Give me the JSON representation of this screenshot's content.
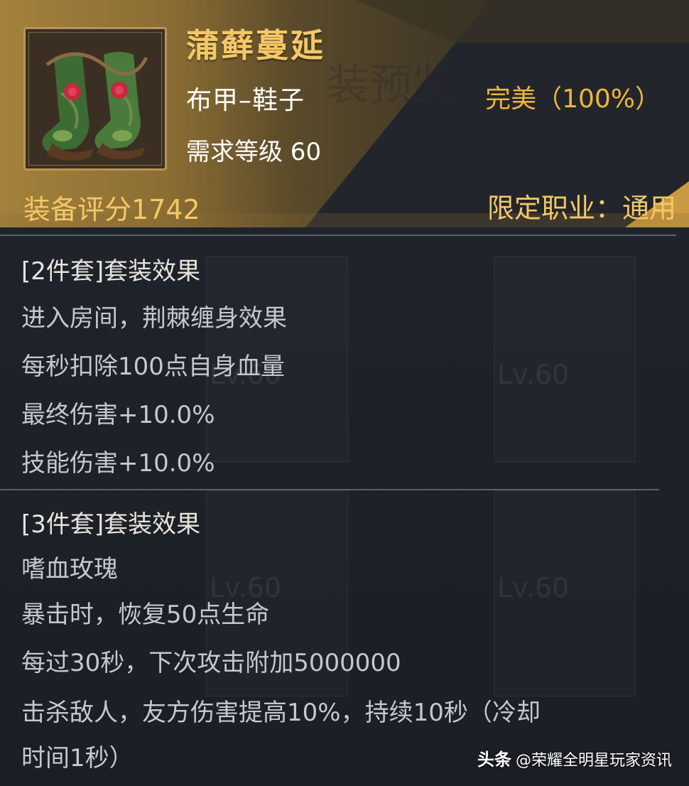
{
  "item": {
    "name": "蒲藓蔓延",
    "type": "布甲–鞋子",
    "required_level": "需求等级 60",
    "quality": "完美（100%）",
    "score": "装备评分1742",
    "class_restriction": "限定职业：通用",
    "icon": "thorn-boots-icon"
  },
  "set_2": {
    "title": "[2件套]套装效果",
    "lines": [
      "进入房间，荆棘缠身效果",
      "每秒扣除100点自身血量",
      "最终伤害+10.0%",
      "技能伤害+10.0%"
    ]
  },
  "set_3": {
    "title": "[3件套]套装效果",
    "lines": [
      "嗜血玫瑰",
      "暴击时，恢复50点生命",
      "每过30秒，下次攻击附加5000000",
      "击杀敌人，友方伤害提高10%，持续10秒（冷却",
      "时间1秒）"
    ]
  },
  "watermark": {
    "brand": "头条",
    "account": "@荣耀全明星玩家资讯"
  },
  "colors": {
    "gold": "#f4c867",
    "quality": "#f0b53a",
    "text": "#c5c8cd",
    "panel": "#1d2128"
  }
}
